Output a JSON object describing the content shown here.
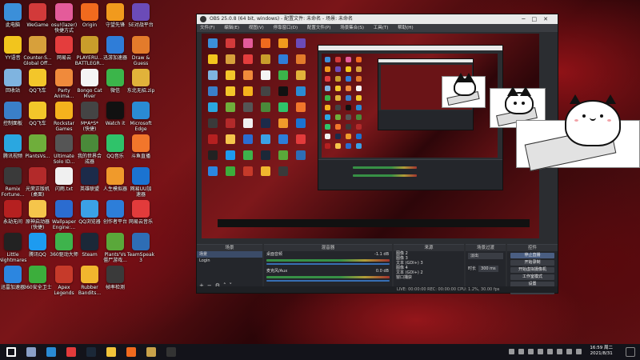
{
  "desktop_icons": [
    {
      "label": "此电脑",
      "icon": "computer-icon",
      "color": "#3b8fd9"
    },
    {
      "label": "WeGame",
      "icon": "wegame-icon",
      "color": "#d23a3a"
    },
    {
      "label": "osu!(lazer)\n快捷方式",
      "icon": "osu-icon",
      "color": "#e45b9a"
    },
    {
      "label": "Origin",
      "icon": "origin-icon",
      "color": "#f06a1e"
    },
    {
      "label": "守望先锋",
      "icon": "overwatch-icon",
      "color": "#f19a1d"
    },
    {
      "label": "5E对战平台",
      "icon": "5e-icon",
      "color": "#6b4bb8"
    },
    {
      "label": "YY语音",
      "icon": "yy-icon",
      "color": "#f2c51d"
    },
    {
      "label": "Counter-S...\nGlobal Off...",
      "icon": "csgo-icon",
      "color": "#d7a03b"
    },
    {
      "label": "网易云",
      "icon": "netease-icon",
      "color": "#e43d3d"
    },
    {
      "label": "PLAYERU...\nBATTLEGR...",
      "icon": "pubg-icon",
      "color": "#c99d2b"
    },
    {
      "label": "迅游加速器",
      "icon": "xunyou-icon",
      "color": "#2f7dd8"
    },
    {
      "label": "Draw &\nGuess",
      "icon": "drawguess-icon",
      "color": "#e37b2b"
    },
    {
      "label": "回收站",
      "icon": "recycle-bin-icon",
      "color": "#7fb4e0"
    },
    {
      "label": "QQ飞车",
      "icon": "qqspeed-icon",
      "color": "#f3c62a"
    },
    {
      "label": "Party\nAnima...",
      "icon": "party-animals-icon",
      "color": "#f08a3b"
    },
    {
      "label": "Bongo Cat\nMver",
      "icon": "bongocat-icon",
      "color": "#f4f4f4"
    },
    {
      "label": "微信",
      "icon": "wechat-icon",
      "color": "#3bb54a"
    },
    {
      "label": "东北无招.zip",
      "icon": "zip-icon",
      "color": "#e1b23a"
    },
    {
      "label": "控制面板",
      "icon": "control-panel-icon",
      "color": "#3a7fc9"
    },
    {
      "label": "QQ飞车",
      "icon": "qqspeed2-icon",
      "color": "#f3c62a"
    },
    {
      "label": "Rockstar\nGames",
      "icon": "rockstar-icon",
      "color": "#f5b21d"
    },
    {
      "label": "M*A*S*\n(快捷)",
      "icon": "mw-icon",
      "color": "#444444"
    },
    {
      "label": "Watch it",
      "icon": "watchit-icon",
      "color": "#111111"
    },
    {
      "label": "Microsoft\nEdge",
      "icon": "edge-icon",
      "color": "#2a8bd4"
    },
    {
      "label": "腾讯视频",
      "icon": "tencent-video-icon",
      "color": "#2aa7e0"
    },
    {
      "label": "PlantsVs...",
      "icon": "plants-icon",
      "color": "#6fae3b"
    },
    {
      "label": "Ultimate\nSolo ID...",
      "icon": "usb-icon",
      "color": "#555555"
    },
    {
      "label": "我的世界合\n成器",
      "icon": "minecraft-icon",
      "color": "#4a8a3a"
    },
    {
      "label": "QQ音乐",
      "icon": "qqmusic-icon",
      "color": "#2fc36a"
    },
    {
      "label": "斗鱼直播",
      "icon": "douyu-icon",
      "color": "#f2762b"
    },
    {
      "label": "Remix\nFortune...",
      "icon": "remix-icon",
      "color": "#3a3a3a"
    },
    {
      "label": "光荣正版机\n(桌面)",
      "icon": "koei-icon",
      "color": "#b32a2a"
    },
    {
      "label": "闪雨.txt",
      "icon": "txt-icon",
      "color": "#f0f0f0"
    },
    {
      "label": "英雄联盟",
      "icon": "lol-icon",
      "color": "#1c2b4a"
    },
    {
      "label": "人生模拟器",
      "icon": "lifesim-icon",
      "color": "#f09a2b"
    },
    {
      "label": "网易UU加\n速器",
      "icon": "uu-icon",
      "color": "#1b73d1"
    },
    {
      "label": "永劫无间",
      "icon": "naraka-icon",
      "color": "#b52020"
    },
    {
      "label": "原神启动器\n(快捷)",
      "icon": "genshin-icon",
      "color": "#f5c54b"
    },
    {
      "label": "Wallpaper\nEngine:...",
      "icon": "wallpaper-engine-icon",
      "color": "#2b6cd0"
    },
    {
      "label": "QQ浏览器",
      "icon": "qqbrowser-icon",
      "color": "#3ba1e6"
    },
    {
      "label": "创作者平台",
      "icon": "creator-icon",
      "color": "#2d7ed9"
    },
    {
      "label": "网易云音乐",
      "icon": "cloudmusic-icon",
      "color": "#e23b3b"
    },
    {
      "label": "Little\nNightmares",
      "icon": "little-nightmares-icon",
      "color": "#222222"
    },
    {
      "label": "腾讯QQ",
      "icon": "qq-icon",
      "color": "#1d9bf0"
    },
    {
      "label": "360驱动大师",
      "icon": "360-icon",
      "color": "#3eb34c"
    },
    {
      "label": "Steam",
      "icon": "steam-icon",
      "color": "#1b2838"
    },
    {
      "label": "Plants'Vs\n僵尸游戏...",
      "icon": "pvz-icon",
      "color": "#5aa83a"
    },
    {
      "label": "TeamSpeak\n3",
      "icon": "teamspeak-icon",
      "color": "#2e6db5"
    },
    {
      "label": "迅雷加速器",
      "icon": "thunder-icon",
      "color": "#2c86e0"
    },
    {
      "label": "360安全卫士",
      "icon": "360safe-icon",
      "color": "#3cae3c"
    },
    {
      "label": "Apex\nLegends",
      "icon": "apex-icon",
      "color": "#c63a2a"
    },
    {
      "label": "Rubber\nBandits...",
      "icon": "rubber-bandits-icon",
      "color": "#f1b62e"
    },
    {
      "label": "帧率检测",
      "icon": "fps-icon",
      "color": "#3a3a3a"
    }
  ],
  "obs": {
    "title": "OBS 25.0.8 (64 bit, windows) - 配置文件: 未命名 - 场景: 未命名",
    "menu": [
      "文件(F)",
      "编辑(E)",
      "视图(V)",
      "停靠窗口(D)",
      "配置文件(P)",
      "场景集合(S)",
      "工具(T)",
      "帮助(H)"
    ],
    "docks": {
      "scenes": {
        "header": "场景",
        "items": [
          "场景",
          "Login"
        ]
      },
      "sources": {
        "header": "来源",
        "items": [
          "图像 2",
          "图像 3",
          "文本 (GDI+) 3",
          "图像 4",
          "文本 (GDI+) 2",
          "窗口捕获"
        ]
      },
      "mixer": {
        "header": "混音器",
        "tracks": [
          {
            "name": "桌面音频",
            "db": "-1.1 dB"
          },
          {
            "name": "麦克风/Aux",
            "db": "0.0 dB"
          }
        ]
      },
      "transitions": {
        "header": "场景过渡",
        "type": "淡出",
        "duration_label": "时长",
        "duration": "300 ms"
      },
      "controls": {
        "header": "控件",
        "buttons": [
          "停止直播",
          "开始录制",
          "开始虚拟摄像机",
          "工作室模式",
          "设置",
          "退出"
        ]
      }
    },
    "status": "LIVE: 00:00:00   REC: 00:00:00   CPU: 1.2%, 30.00 fps"
  },
  "taskbar": {
    "time": "16:59 周二",
    "date": "2021/8/31",
    "apps": [
      "start-icon",
      "task-view-icon",
      "edge-icon",
      "netease-icon",
      "steam-icon",
      "explorer-icon",
      "origin-icon",
      "lol-icon",
      "obs-icon"
    ]
  }
}
